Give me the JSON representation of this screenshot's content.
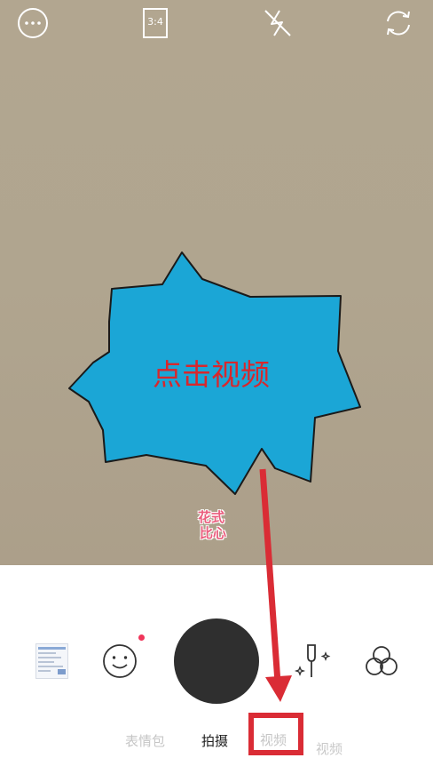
{
  "camera": {
    "ratio_label": "3:4"
  },
  "modes": {
    "sticker": "表情包",
    "photo": "拍摄",
    "video": "视频",
    "video_ghost": "视频"
  },
  "annotation": {
    "callout_text": "点击视频",
    "sticker_line1": "花式",
    "sticker_line2": "比心"
  },
  "colors": {
    "callout_fill": "#1ba6d6",
    "annotation_red": "#d8272c",
    "shutter": "#2f2f2f",
    "notification_dot": "#f0355a"
  },
  "icons": {
    "more": "more-horizontal-icon",
    "ratio": "aspect-ratio-icon",
    "flash": "flash-off-icon",
    "switch": "camera-switch-icon",
    "gallery": "gallery-thumbnail",
    "emoji": "smiley-icon",
    "beauty": "magic-wand-icon",
    "filter": "filter-circles-icon"
  }
}
